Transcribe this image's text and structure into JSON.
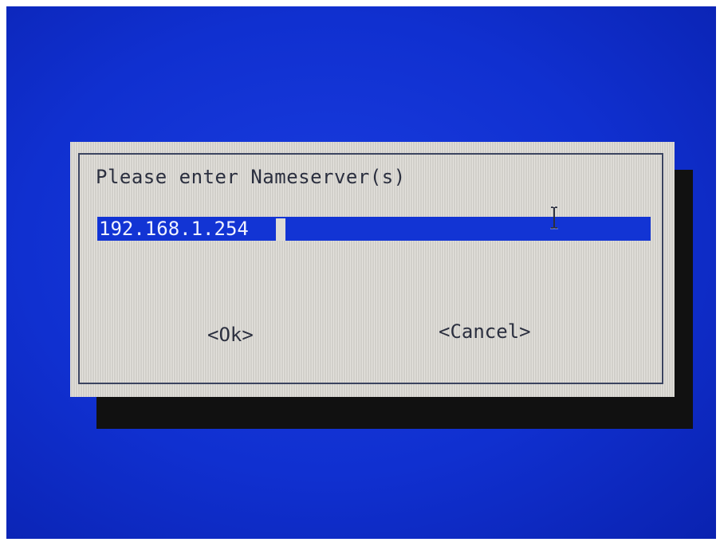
{
  "dialog": {
    "prompt": "Please enter Nameserver(s)",
    "input_value": "192.168.1.254",
    "ok_label": "<Ok>",
    "cancel_label": "<Cancel>"
  },
  "colors": {
    "screen_background": "#1030d0",
    "dialog_background": "#dedcd6",
    "input_background": "#1234d4",
    "shadow": "#111111",
    "text": "#2b2f3f"
  },
  "icons": {
    "mouse_pointer": "i-beam-cursor-icon"
  }
}
